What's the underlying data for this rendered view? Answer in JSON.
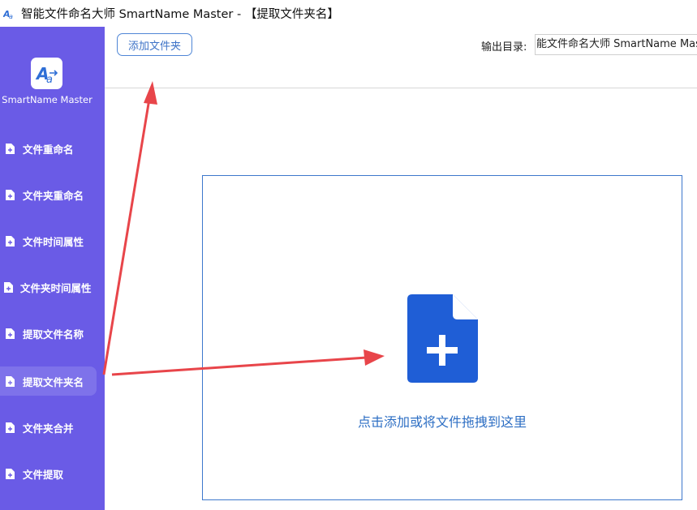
{
  "window": {
    "title": "智能文件命名大师 SmartName Master - 【提取文件夹名】"
  },
  "sidebar": {
    "brand": "SmartName Master",
    "items": [
      {
        "label": "文件重命名"
      },
      {
        "label": "文件夹重命名"
      },
      {
        "label": "文件时间属性"
      },
      {
        "label": "文件夹时间属性"
      },
      {
        "label": "提取文件名称"
      },
      {
        "label": "提取文件夹名"
      },
      {
        "label": "文件夹合并"
      },
      {
        "label": "文件提取"
      }
    ],
    "active_index": 5
  },
  "toolbar": {
    "add_folder_label": "添加文件夹",
    "output_label": "输出目录:",
    "output_value": "能文件命名大师 SmartName Mas"
  },
  "dropzone": {
    "text": "点击添加或将文件拖拽到这里",
    "icon": "file-add-icon"
  },
  "colors": {
    "sidebar_bg": "#6a5be6",
    "active_item_bg": "#7e72ea",
    "accent_blue": "#1f5ed6",
    "link_blue": "#2e6fc4",
    "annotation_red": "#e8454a"
  }
}
